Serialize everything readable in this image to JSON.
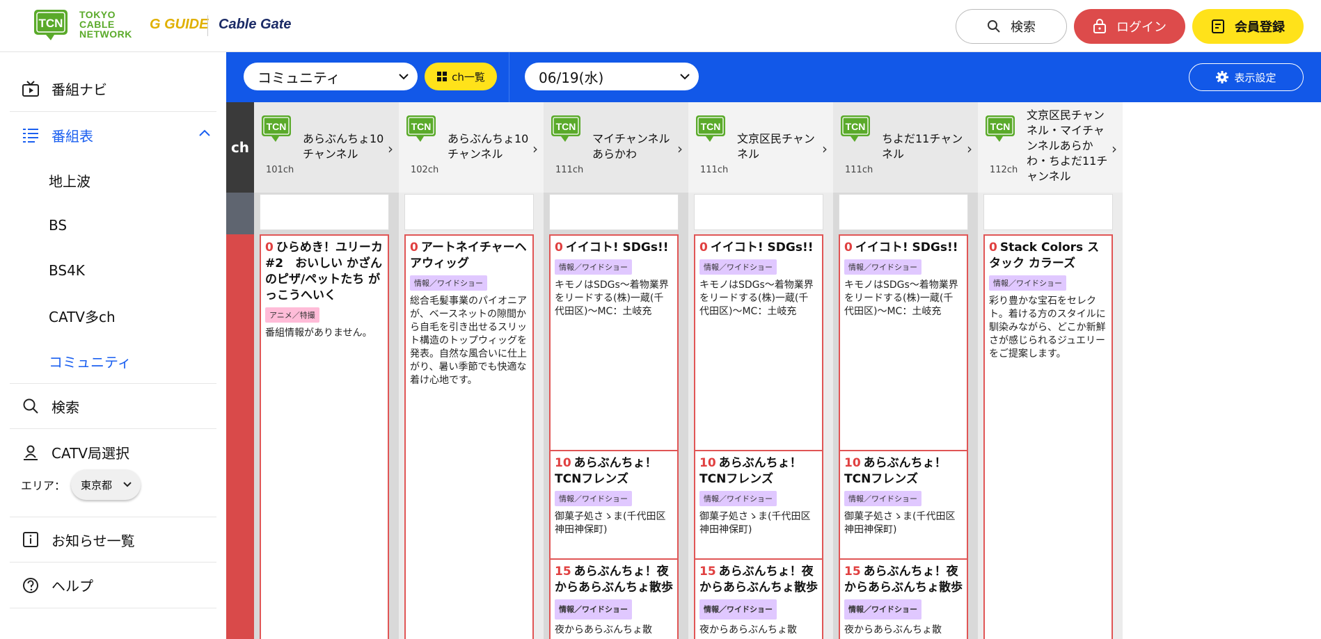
{
  "header": {
    "logo_line1": "TOKYO",
    "logo_line2": "CABLE",
    "logo_line3": "NETWORK",
    "logo_mark": "TCN",
    "logo_gguide": "G GUIDE",
    "logo_cablegate": "Cable Gate",
    "search_label": "検索",
    "login_label": "ログイン",
    "register_label": "会員登録"
  },
  "sidebar": {
    "nav_guide": "番組ナビ",
    "nav_schedule": "番組表",
    "sub_items": [
      "地上波",
      "BS",
      "BS4K",
      "CATV多ch",
      "コミュニティ"
    ],
    "nav_search": "検索",
    "nav_catv": "CATV局選択",
    "area_label": "エリア：",
    "area_value": "東京都",
    "nav_news": "お知らせ一覧",
    "nav_help": "ヘルプ"
  },
  "toolbar": {
    "genre_value": "コミュニティ",
    "chlist_label": "ch一覧",
    "date_value": "06/19(水)",
    "display_label": "表示設定"
  },
  "grid": {
    "ch_label": "ch",
    "channels": [
      {
        "name": "あらぶんちょ10チャンネル",
        "num": "101ch"
      },
      {
        "name": "あらぶんちょ10チャンネル",
        "num": "102ch"
      },
      {
        "name": "マイチャンネルあらかわ",
        "num": "111ch"
      },
      {
        "name": "文京区民チャンネル",
        "num": "111ch"
      },
      {
        "name": "ちよだ11チャンネル",
        "num": "111ch"
      },
      {
        "name": "文京区民チャンネル・マイチャンネルあらかわ・ちよだ11チャンネル",
        "num": "112ch"
      }
    ],
    "programs": [
      [
        {
          "min": "0",
          "title": "ひらめき！ユリーカ#2　おいしい かざんのピザ/ペットたち がっこうへいく",
          "tag": "アニメ／特撮",
          "desc": "番組情報がありません。"
        }
      ],
      [
        {
          "min": "0",
          "title": "アートネイチャーヘアウィッグ",
          "tag": "情報／ワイドショー",
          "desc": "総合毛髪事業のパイオニアが、ベースネットの隙間から自毛を引き出せるスリット構造のトップウィッグを発表。自然な風合いに仕上がり、暑い季節でも快適な着け心地です。"
        }
      ],
      [
        {
          "min": "0",
          "title": "イイコト! SDGs!!",
          "tag": "情報／ワイドショー",
          "desc": "キモノはSDGs～着物業界をリードする(株)一蔵(千代田区)～MC：土岐充"
        },
        {
          "min": "10",
          "title": "あらぶんちょ！TCNフレンズ",
          "tag": "情報／ワイドショー",
          "desc": "御菓子処さゝま(千代田区神田神保町)"
        },
        {
          "min": "15",
          "title": "あらぶんちょ！夜からあらぶんちょ散歩",
          "tag": "情報／ワイドショー",
          "desc": "夜からあらぶんちょ散"
        }
      ],
      [
        {
          "min": "0",
          "title": "イイコト! SDGs!!",
          "tag": "情報／ワイドショー",
          "desc": "キモノはSDGs～着物業界をリードする(株)一蔵(千代田区)～MC：土岐充"
        },
        {
          "min": "10",
          "title": "あらぶんちょ！TCNフレンズ",
          "tag": "情報／ワイドショー",
          "desc": "御菓子処さゝま(千代田区神田神保町)"
        },
        {
          "min": "15",
          "title": "あらぶんちょ！夜からあらぶんちょ散歩",
          "tag": "情報／ワイドショー",
          "desc": "夜からあらぶんちょ散"
        }
      ],
      [
        {
          "min": "0",
          "title": "イイコト! SDGs!!",
          "tag": "情報／ワイドショー",
          "desc": "キモノはSDGs～着物業界をリードする(株)一蔵(千代田区)～MC：土岐充"
        },
        {
          "min": "10",
          "title": "あらぶんちょ！TCNフレンズ",
          "tag": "情報／ワイドショー",
          "desc": "御菓子処さゝま(千代田区神田神保町)"
        },
        {
          "min": "15",
          "title": "あらぶんちょ！夜からあらぶんちょ散歩",
          "tag": "情報／ワイドショー",
          "desc": "夜からあらぶんちょ散"
        }
      ],
      [
        {
          "min": "0",
          "title": "Stack Colors スタック カラーズ",
          "tag": "情報／ワイドショー",
          "desc": "彩り豊かな宝石をセレクト。着ける方のスタイルに馴染みながら、どこか新鮮さが感じられるジュエリーをご提案します。"
        }
      ]
    ],
    "colors": {
      "accent": "#1258e8",
      "now": "#d94a4a",
      "login": "#dd4b4b",
      "yellow": "#ffe21a",
      "tcn_green": "#5aaa2a"
    }
  }
}
